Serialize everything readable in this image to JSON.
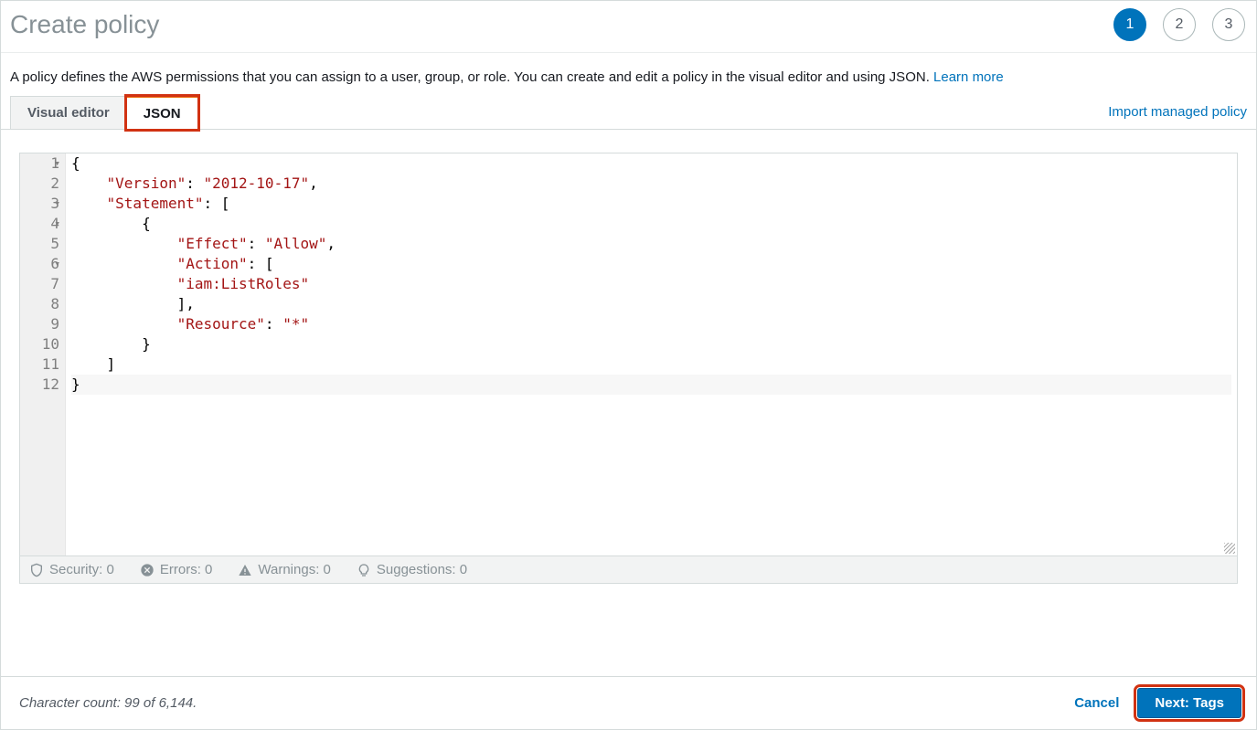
{
  "header": {
    "title": "Create policy",
    "steps": [
      "1",
      "2",
      "3"
    ],
    "activeStep": 0
  },
  "description": {
    "text": "A policy defines the AWS permissions that you can assign to a user, group, or role. You can create and edit a policy in the visual editor and using JSON. ",
    "learn_more": "Learn more"
  },
  "tabs": {
    "visual": "Visual editor",
    "json": "JSON",
    "import": "Import managed policy"
  },
  "editor": {
    "lines": [
      {
        "n": "1",
        "fold": true,
        "html": "<span class='p'>{</span>"
      },
      {
        "n": "2",
        "fold": false,
        "html": "    <span class='s'>\"Version\"</span><span class='p'>: </span><span class='s'>\"2012-10-17\"</span><span class='p'>,</span>"
      },
      {
        "n": "3",
        "fold": true,
        "html": "    <span class='s'>\"Statement\"</span><span class='p'>: [</span>"
      },
      {
        "n": "4",
        "fold": true,
        "html": "        <span class='p'>{</span>"
      },
      {
        "n": "5",
        "fold": false,
        "html": "            <span class='s'>\"Effect\"</span><span class='p'>: </span><span class='s'>\"Allow\"</span><span class='p'>,</span>"
      },
      {
        "n": "6",
        "fold": true,
        "html": "            <span class='s'>\"Action\"</span><span class='p'>: [</span>"
      },
      {
        "n": "7",
        "fold": false,
        "html": "            <span class='s'>\"iam:ListRoles\"</span>"
      },
      {
        "n": "8",
        "fold": false,
        "html": "            <span class='p'>],</span>"
      },
      {
        "n": "9",
        "fold": false,
        "html": "            <span class='s'>\"Resource\"</span><span class='p'>: </span><span class='s'>\"*\"</span>"
      },
      {
        "n": "10",
        "fold": false,
        "html": "        <span class='p'>}</span>"
      },
      {
        "n": "11",
        "fold": false,
        "html": "    <span class='p'>]</span>"
      },
      {
        "n": "12",
        "fold": false,
        "html": "<span class='p'>}</span>",
        "cursor": true
      }
    ]
  },
  "status": {
    "security": "Security: 0",
    "errors": "Errors: 0",
    "warnings": "Warnings: 0",
    "suggestions": "Suggestions: 0"
  },
  "footer": {
    "char_count": "Character count: 99 of 6,144.",
    "cancel": "Cancel",
    "next": "Next: Tags"
  }
}
